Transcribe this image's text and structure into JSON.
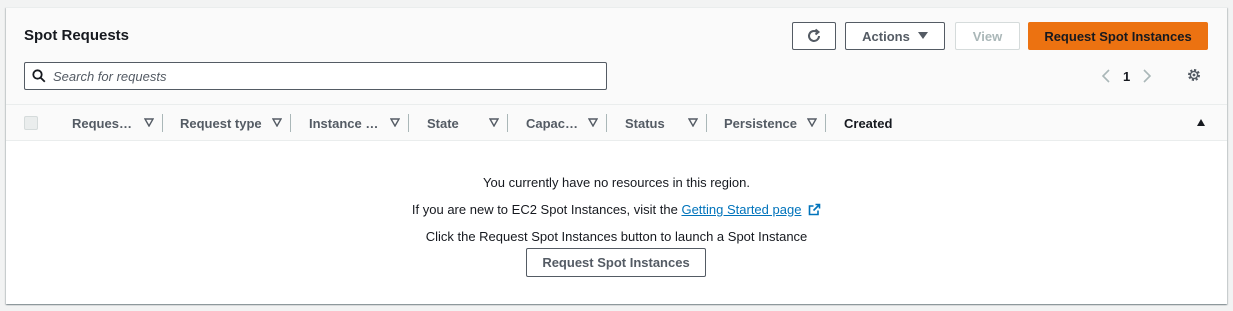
{
  "header": {
    "title": "Spot Requests",
    "actions_label": "Actions",
    "view_label": "View",
    "request_label": "Request Spot Instances"
  },
  "search": {
    "placeholder": "Search for requests"
  },
  "pagination": {
    "current_page": "1"
  },
  "table": {
    "columns": [
      "Reques…",
      "Request type",
      "Instance …",
      "State",
      "Capac…",
      "Status",
      "Persistence",
      "Created"
    ]
  },
  "empty_state": {
    "line1": "You currently have no resources in this region.",
    "line2_prefix": "If you are new to EC2 Spot Instances, visit the ",
    "line2_link": "Getting Started page",
    "line3": "Click the Request Spot Instances button to launch a Spot Instance",
    "button_label": "Request Spot Instances"
  },
  "colors": {
    "primary": "#ec7211",
    "link": "#0073bb",
    "border": "#545b64"
  }
}
